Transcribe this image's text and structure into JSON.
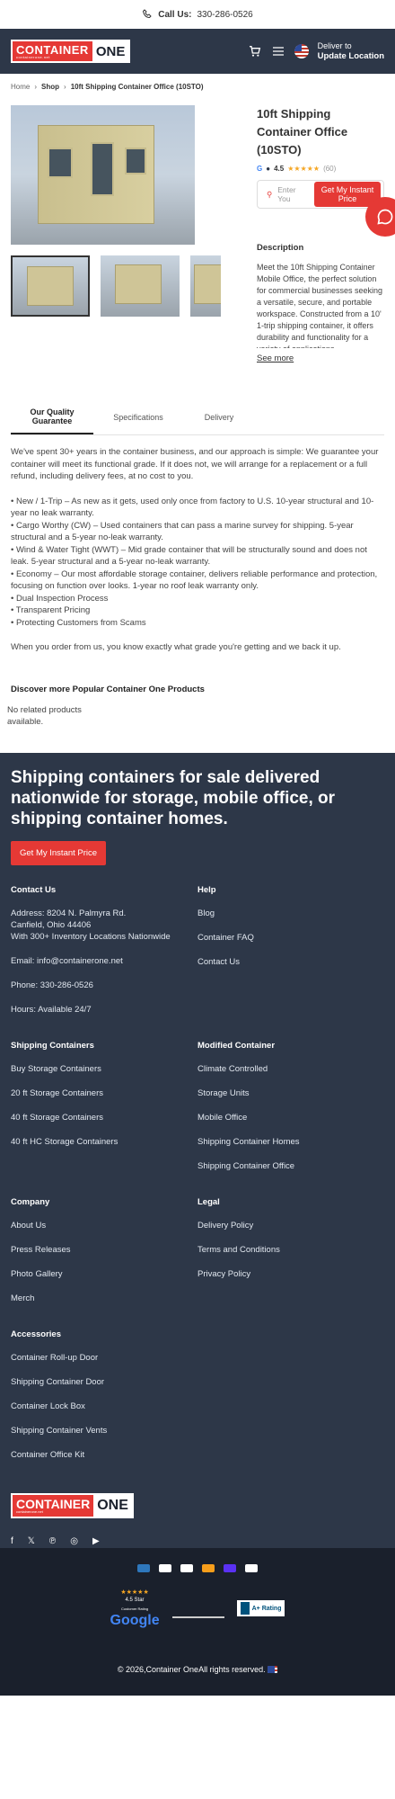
{
  "topbar": {
    "call_label": "Call Us:",
    "phone": "330-286-0526"
  },
  "logo": {
    "part1": "CONTAINER",
    "part2": "ONE",
    "tagline": "containerone.net"
  },
  "header": {
    "deliver_to": "Deliver to",
    "update_location": "Update Location"
  },
  "breadcrumb": {
    "home": "Home",
    "shop": "Shop",
    "current": "10ft Shipping Container Office (10STO)"
  },
  "product": {
    "title": "10ft Shipping Container Office (10STO)",
    "rating": "4.5",
    "stars": "★★★★★",
    "reviews": "(60)",
    "zip_placeholder": "Enter You",
    "zip_button": "Get My Instant Price",
    "description_heading": "Description",
    "description": "Meet the 10ft Shipping Container Mobile Office, the perfect solution for commercial businesses seeking a versatile, secure, and portable workspace. Constructed from a 10' 1-trip shipping container, it offers durability and functionality for a variety of applications.",
    "see_more": "See more"
  },
  "tabs": [
    {
      "label": "Our Quality Guarantee"
    },
    {
      "label": "Specifications"
    },
    {
      "label": "Delivery"
    }
  ],
  "guarantee": {
    "intro": "We've spent 30+ years in the container business, and our approach is simple: We guarantee your container will meet its functional grade. If it does not, we will arrange for a replacement or a full refund, including delivery fees, at no cost to you.",
    "items": [
      "• New / 1-Trip – As new as it gets, used only once from factory to U.S. 10-year structural and 10-year no leak warranty.",
      "• Cargo Worthy (CW) – Used containers that can pass a marine survey for shipping. 5-year structural and a 5-year no-leak warranty.",
      "• Wind & Water Tight (WWT) – Mid grade container that will be structurally sound and does not leak. 5-year structural and a 5-year no-leak warranty.",
      "• Economy – Our most affordable storage container, delivers reliable performance and protection, focusing on function over looks. 1-year no roof leak warranty only.",
      "• Dual Inspection Process",
      "• Transparent Pricing",
      "• Protecting Customers from Scams"
    ],
    "outro": "When you order from us, you know exactly what grade you're getting and we back it up."
  },
  "related": {
    "heading": "Discover more Popular Container One Products",
    "empty": "No related products available."
  },
  "footer": {
    "headline": "Shipping containers for sale delivered nationwide for storage, mobile office, or shipping container homes.",
    "cta": "Get My Instant Price",
    "contact": {
      "heading": "Contact Us",
      "address1": "Address: 8204 N. Palmyra Rd.",
      "address2": "Canfield, Ohio 44406",
      "address3": "With 300+ Inventory Locations Nationwide",
      "email": "Email: info@containerone.net",
      "phone": "Phone: 330-286-0526",
      "hours": "Hours: Available 24/7"
    },
    "help": {
      "heading": "Help",
      "items": [
        "Blog",
        "Container FAQ",
        "Contact Us"
      ]
    },
    "shipping": {
      "heading": "Shipping Containers",
      "items": [
        "Buy Storage Containers",
        "20 ft Storage Containers",
        "40 ft Storage Containers",
        "40 ft HC Storage Containers"
      ]
    },
    "modified": {
      "heading": "Modified Container",
      "items": [
        "Climate Controlled",
        "Storage Units",
        "Mobile Office",
        "Shipping Container Homes",
        "Shipping Container Office"
      ]
    },
    "company": {
      "heading": "Company",
      "items": [
        "About Us",
        "Press Releases",
        "Photo Gallery",
        "Merch"
      ]
    },
    "legal": {
      "heading": "Legal",
      "items": [
        "Delivery Policy",
        "Terms and Conditions",
        "Privacy Policy"
      ]
    },
    "accessories": {
      "heading": "Accessories",
      "items": [
        "Container Roll-up Door",
        "Shipping Container Door",
        "Container Lock Box",
        "Shipping Container Vents",
        "Container Office Kit"
      ]
    }
  },
  "badges": {
    "google_rating": "4.5 Star",
    "google_sub": "Customer Rating",
    "google": "Google",
    "bbb": "A+ Rating"
  },
  "copyright": "© 2026,Container OneAll rights reserved."
}
